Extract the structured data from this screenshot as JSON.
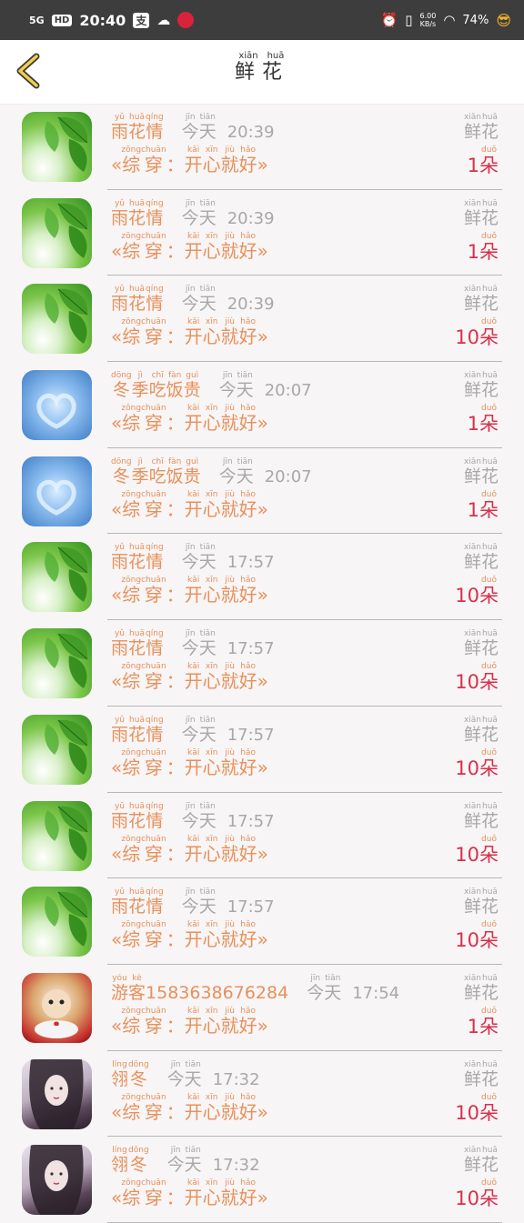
{
  "status_bar": {
    "network": "5G",
    "hd": "HD",
    "time": "20:40",
    "pay_icon": "支",
    "speed": "6.00",
    "speed_unit": "KB/s",
    "battery": "74%"
  },
  "header": {
    "title": [
      {
        "c": "鲜",
        "p": "xiān"
      },
      {
        "c": "花",
        "p": "huā"
      }
    ]
  },
  "labels": {
    "today": [
      {
        "c": "今",
        "p": "jīn"
      },
      {
        "c": "天",
        "p": "tiān"
      }
    ],
    "flower": [
      {
        "c": "鲜",
        "p": "xiān"
      },
      {
        "c": "花",
        "p": "huā"
      }
    ],
    "duo": {
      "c": "朵",
      "p": "duǒ"
    },
    "book_open": "«",
    "book_close": "»",
    "colon": "："
  },
  "book_title": [
    {
      "c": "综",
      "p": "zōng"
    },
    {
      "c": "穿",
      "p": "chuān"
    },
    {
      "c": "：",
      "p": ""
    },
    {
      "c": "开",
      "p": "kāi"
    },
    {
      "c": "心",
      "p": "xīn"
    },
    {
      "c": "就",
      "p": "jiù"
    },
    {
      "c": "好",
      "p": "hǎo"
    }
  ],
  "rows": [
    {
      "avatar": "leaf",
      "name": [
        {
          "c": "雨",
          "p": "yǔ"
        },
        {
          "c": "花",
          "p": "huā"
        },
        {
          "c": "情",
          "p": "qíng"
        }
      ],
      "time": "20:39",
      "count": "1"
    },
    {
      "avatar": "leaf",
      "name": [
        {
          "c": "雨",
          "p": "yǔ"
        },
        {
          "c": "花",
          "p": "huā"
        },
        {
          "c": "情",
          "p": "qíng"
        }
      ],
      "time": "20:39",
      "count": "1"
    },
    {
      "avatar": "leaf",
      "name": [
        {
          "c": "雨",
          "p": "yǔ"
        },
        {
          "c": "花",
          "p": "huā"
        },
        {
          "c": "情",
          "p": "qíng"
        }
      ],
      "time": "20:39",
      "count": "10"
    },
    {
      "avatar": "ice",
      "name": [
        {
          "c": "冬",
          "p": "dōng"
        },
        {
          "c": "季",
          "p": "jì"
        },
        {
          "c": "吃",
          "p": "chī"
        },
        {
          "c": "饭",
          "p": "fàn"
        },
        {
          "c": "贵",
          "p": "guì"
        }
      ],
      "time": "20:07",
      "count": "1"
    },
    {
      "avatar": "ice",
      "name": [
        {
          "c": "冬",
          "p": "dōng"
        },
        {
          "c": "季",
          "p": "jì"
        },
        {
          "c": "吃",
          "p": "chī"
        },
        {
          "c": "饭",
          "p": "fàn"
        },
        {
          "c": "贵",
          "p": "guì"
        }
      ],
      "time": "20:07",
      "count": "1"
    },
    {
      "avatar": "leaf",
      "name": [
        {
          "c": "雨",
          "p": "yǔ"
        },
        {
          "c": "花",
          "p": "huā"
        },
        {
          "c": "情",
          "p": "qíng"
        }
      ],
      "time": "17:57",
      "count": "10"
    },
    {
      "avatar": "leaf",
      "name": [
        {
          "c": "雨",
          "p": "yǔ"
        },
        {
          "c": "花",
          "p": "huā"
        },
        {
          "c": "情",
          "p": "qíng"
        }
      ],
      "time": "17:57",
      "count": "10"
    },
    {
      "avatar": "leaf",
      "name": [
        {
          "c": "雨",
          "p": "yǔ"
        },
        {
          "c": "花",
          "p": "huā"
        },
        {
          "c": "情",
          "p": "qíng"
        }
      ],
      "time": "17:57",
      "count": "10"
    },
    {
      "avatar": "leaf",
      "name": [
        {
          "c": "雨",
          "p": "yǔ"
        },
        {
          "c": "花",
          "p": "huā"
        },
        {
          "c": "情",
          "p": "qíng"
        }
      ],
      "time": "17:57",
      "count": "10"
    },
    {
      "avatar": "leaf",
      "name": [
        {
          "c": "雨",
          "p": "yǔ"
        },
        {
          "c": "花",
          "p": "huā"
        },
        {
          "c": "情",
          "p": "qíng"
        }
      ],
      "time": "17:57",
      "count": "10"
    },
    {
      "avatar": "dog",
      "name": [
        {
          "c": "游",
          "p": "yóu"
        },
        {
          "c": "客",
          "p": "kè"
        },
        {
          "c": "1583638676284",
          "p": ""
        }
      ],
      "time": "17:54",
      "count": "1"
    },
    {
      "avatar": "girl",
      "name": [
        {
          "c": "翎",
          "p": "líng"
        },
        {
          "c": "冬",
          "p": "dōng"
        }
      ],
      "time": "17:32",
      "count": "10"
    },
    {
      "avatar": "girl",
      "name": [
        {
          "c": "翎",
          "p": "líng"
        },
        {
          "c": "冬",
          "p": "dōng"
        }
      ],
      "time": "17:32",
      "count": "10"
    }
  ]
}
